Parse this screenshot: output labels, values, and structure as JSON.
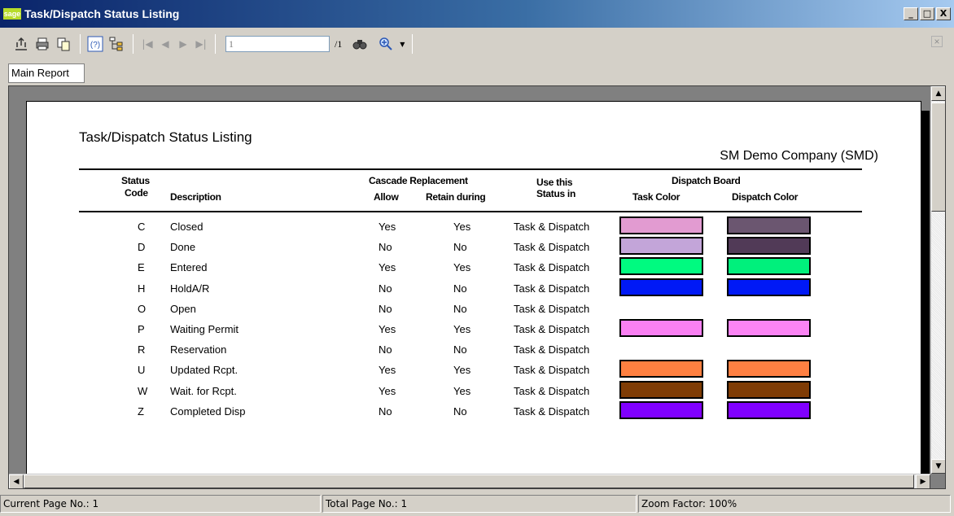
{
  "window": {
    "logo_text": "sage",
    "title": "Task/Dispatch Status Listing",
    "minimize": "_",
    "maximize": "□",
    "close": "X"
  },
  "toolbar": {
    "page_value": "1",
    "page_total": "/1",
    "icons": [
      "export-icon",
      "print-icon",
      "copy-icon",
      "help-icon",
      "group-tree-icon",
      "first-page-icon",
      "prev-page-icon",
      "next-page-icon",
      "last-page-icon",
      "search-icon",
      "zoom-icon"
    ]
  },
  "tabs": {
    "main": "Main Report"
  },
  "report": {
    "title": "Task/Dispatch Status Listing",
    "company": "SM Demo Company (SMD)",
    "headers": {
      "status_code_1": "Status",
      "status_code_2": "Code",
      "description": "Description",
      "cascade": "Cascade Replacement",
      "allow": "Allow",
      "retain": "Retain during",
      "use_this_1": "Use this",
      "use_this_2": "Status in",
      "dispatch_board": "Dispatch Board",
      "task_color": "Task Color",
      "dispatch_color": "Dispatch Color"
    },
    "rows": [
      {
        "code": "C",
        "description": "Closed",
        "allow": "Yes",
        "retain": "Yes",
        "use": "Task & Dispatch",
        "task_color": "#e29bd1",
        "dispatch_color": "#6b5670"
      },
      {
        "code": "D",
        "description": "Done",
        "allow": "No",
        "retain": "No",
        "use": "Task & Dispatch",
        "task_color": "#c3a5d9",
        "dispatch_color": "#513a57"
      },
      {
        "code": "E",
        "description": "Entered",
        "allow": "Yes",
        "retain": "Yes",
        "use": "Task & Dispatch",
        "task_color": "#00fa80",
        "dispatch_color": "#00f07c"
      },
      {
        "code": "H",
        "description": "HoldA/R",
        "allow": "No",
        "retain": "No",
        "use": "Task & Dispatch",
        "task_color": "#0019f6",
        "dispatch_color": "#0019f6"
      },
      {
        "code": "O",
        "description": "Open",
        "allow": "No",
        "retain": "No",
        "use": "Task & Dispatch",
        "task_color": "",
        "dispatch_color": ""
      },
      {
        "code": "P",
        "description": "Waiting Permit",
        "allow": "Yes",
        "retain": "Yes",
        "use": "Task & Dispatch",
        "task_color": "#fa80f3",
        "dispatch_color": "#fb84f4"
      },
      {
        "code": "R",
        "description": "Reservation",
        "allow": "No",
        "retain": "No",
        "use": "Task & Dispatch",
        "task_color": "",
        "dispatch_color": ""
      },
      {
        "code": "U",
        "description": "Updated Rcpt.",
        "allow": "Yes",
        "retain": "Yes",
        "use": "Task & Dispatch",
        "task_color": "#ff8040",
        "dispatch_color": "#ff8042"
      },
      {
        "code": "W",
        "description": "Wait. for Rcpt.",
        "allow": "Yes",
        "retain": "Yes",
        "use": "Task & Dispatch",
        "task_color": "#7f3c05",
        "dispatch_color": "#7f3c05"
      },
      {
        "code": "Z",
        "description": "Completed Disp",
        "allow": "No",
        "retain": "No",
        "use": "Task & Dispatch",
        "task_color": "#8000ff",
        "dispatch_color": "#8000ff"
      }
    ]
  },
  "statusbar": {
    "current_page": "Current Page No.: 1",
    "total_page": "Total Page No.: 1",
    "zoom": "Zoom Factor: 100%"
  }
}
